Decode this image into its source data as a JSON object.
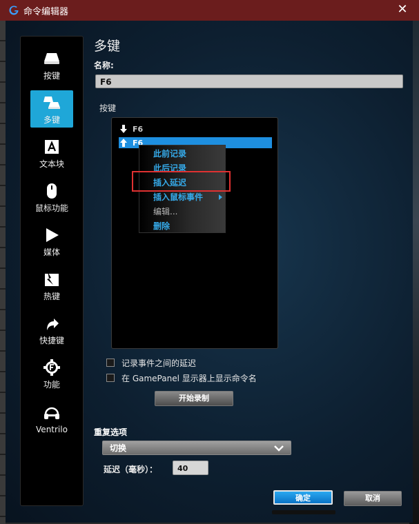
{
  "window": {
    "title": "命令编辑器",
    "close_glyph": "✕",
    "accent": "#1fa7d8",
    "titlebar_color": "#6b1d1d"
  },
  "sidebar": {
    "items": [
      {
        "label": "按键",
        "icon": "keycap-icon"
      },
      {
        "label": "多键",
        "icon": "multikey-icon",
        "active": true
      },
      {
        "label": "文本块",
        "icon": "text-block-icon"
      },
      {
        "label": "鼠标功能",
        "icon": "mouse-icon"
      },
      {
        "label": "媒体",
        "icon": "play-icon"
      },
      {
        "label": "热键",
        "icon": "hotkey-icon"
      },
      {
        "label": "快捷键",
        "icon": "shortcut-arrow-icon"
      },
      {
        "label": "功能",
        "icon": "function-gear-icon"
      },
      {
        "label": "Ventrilo",
        "icon": "headset-icon"
      }
    ]
  },
  "main": {
    "heading": "多键",
    "name_label": "名称:",
    "name_value": "F6",
    "keys_label": "按键",
    "keys": [
      {
        "text": "F6",
        "direction": "down"
      },
      {
        "text": "F6",
        "direction": "up",
        "selected": true
      }
    ],
    "context_menu": [
      {
        "label": "此前记录"
      },
      {
        "label": "此后记录"
      },
      {
        "label": "插入延迟",
        "highlighted": true
      },
      {
        "label": "插入鼠标事件",
        "submenu": true
      },
      {
        "label": "编辑...",
        "disabled": true
      },
      {
        "label": "删除"
      }
    ],
    "checkboxes": [
      {
        "label": "记录事件之间的延迟",
        "checked": false
      },
      {
        "label": "在 GamePanel 显示器上显示命令名",
        "checked": false
      }
    ],
    "record_button": "开始录制"
  },
  "repeat": {
    "label": "重复选项",
    "selected": "切换",
    "delay_label": "延迟（毫秒）：",
    "delay_value": "40"
  },
  "footer": {
    "ok": "确定",
    "cancel": "取消"
  }
}
